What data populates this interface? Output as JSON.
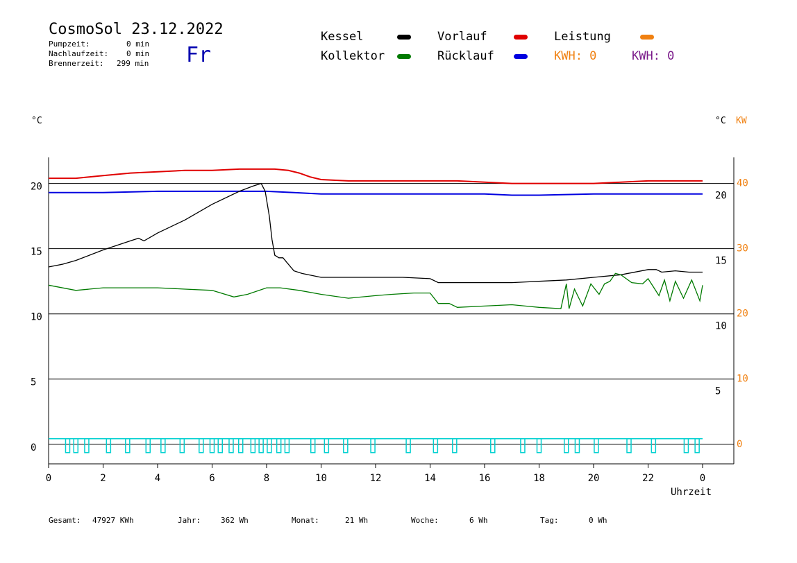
{
  "header": {
    "app_title": "CosmoSol 23.12.2022",
    "day": "Fr",
    "pumpzeit_label": "Pumpzeit:",
    "pumpzeit_value": "0 min",
    "nachlaufzeit_label": "Nachlaufzeit:",
    "nachlaufzeit_value": "0 min",
    "brennerzeit_label": "Brennerzeit:",
    "brennerzeit_value": "299 min"
  },
  "legend": {
    "kessel": "Kessel",
    "vorlauf": "Vorlauf",
    "leistung": "Leistung",
    "kollektor": "Kollektor",
    "ruecklauf": "Rücklauf",
    "kwh1": "KWH: 0",
    "kwh2": "KWH: 0",
    "colors": {
      "kessel": "#000000",
      "vorlauf": "#e00000",
      "leistung": "#f08010",
      "kollektor": "#007a00",
      "ruecklauf": "#0000e0",
      "kwh2": "#7a1a8a",
      "pump": "#00d0d0"
    }
  },
  "footer": {
    "gesamt_label": "Gesamt:",
    "gesamt_value": "47927 KWh",
    "jahr_label": "Jahr:",
    "jahr_value": "362 Wh",
    "monat_label": "Monat:",
    "monat_value": "21 Wh",
    "woche_label": "Woche:",
    "woche_value": "6 Wh",
    "tag_label": "Tag:",
    "tag_value": "0 Wh"
  },
  "chart_data": {
    "type": "line",
    "xlabel": "Uhrzeit",
    "ylabel_left": "°C",
    "ylabel_right": "°C",
    "ylabel_right2": "KW",
    "xlim": [
      0,
      24
    ],
    "ylim": [
      -1.5,
      22
    ],
    "grid": true,
    "x_ticks": [
      "0",
      "2",
      "4",
      "6",
      "8",
      "10",
      "12",
      "14",
      "16",
      "18",
      "20",
      "22",
      "0"
    ],
    "y_ticks_left": [
      "0",
      "5",
      "10",
      "15",
      "20"
    ],
    "y_ticks_right": [
      "5",
      "10",
      "15",
      "20"
    ],
    "y_ticks_kw": [
      "0",
      "10",
      "20",
      "30",
      "40"
    ],
    "series": [
      {
        "name": "Vorlauf",
        "color": "#e00000",
        "x": [
          0,
          1,
          2,
          3,
          4,
          5,
          6,
          7,
          7.5,
          8,
          8.3,
          8.8,
          9.2,
          9.6,
          10,
          11,
          12,
          13,
          14,
          15,
          16,
          17,
          18,
          19,
          20,
          21,
          22,
          23,
          24
        ],
        "y": [
          20.4,
          20.4,
          20.6,
          20.8,
          20.9,
          21.0,
          21.0,
          21.1,
          21.1,
          21.1,
          21.1,
          21.0,
          20.8,
          20.5,
          20.3,
          20.2,
          20.2,
          20.2,
          20.2,
          20.2,
          20.1,
          20.0,
          20.0,
          20.0,
          20.0,
          20.1,
          20.2,
          20.2,
          20.2
        ]
      },
      {
        "name": "Rücklauf",
        "color": "#0000e0",
        "x": [
          0,
          2,
          4,
          6,
          8,
          9,
          10,
          12,
          14,
          16,
          17,
          18,
          20,
          22,
          24
        ],
        "y": [
          19.3,
          19.3,
          19.4,
          19.4,
          19.4,
          19.3,
          19.2,
          19.2,
          19.2,
          19.2,
          19.1,
          19.1,
          19.2,
          19.2,
          19.2
        ]
      },
      {
        "name": "Kessel",
        "color": "#000000",
        "x": [
          0,
          0.5,
          1,
          2,
          3,
          3.3,
          3.5,
          4,
          5,
          6,
          7,
          7.5,
          7.8,
          7.95,
          8.1,
          8.2,
          8.3,
          8.45,
          8.6,
          9,
          9.3,
          10,
          11,
          12,
          13,
          14,
          14.3,
          15,
          16,
          17,
          18,
          19,
          20,
          21,
          22,
          22.3,
          22.5,
          23,
          23.5,
          24
        ],
        "y": [
          13.6,
          13.8,
          14.1,
          14.9,
          15.6,
          15.8,
          15.6,
          16.2,
          17.2,
          18.4,
          19.4,
          19.8,
          20.0,
          19.4,
          17.5,
          15.7,
          14.5,
          14.3,
          14.3,
          13.3,
          13.1,
          12.8,
          12.8,
          12.8,
          12.8,
          12.7,
          12.4,
          12.4,
          12.4,
          12.4,
          12.5,
          12.6,
          12.8,
          13.0,
          13.4,
          13.4,
          13.2,
          13.3,
          13.2,
          13.2
        ]
      },
      {
        "name": "Kollektor",
        "color": "#007a00",
        "x": [
          0,
          1,
          2,
          3,
          4,
          5,
          6,
          6.8,
          7.3,
          8,
          8.5,
          9.2,
          10,
          11,
          12,
          12.6,
          13.4,
          14,
          14.3,
          14.7,
          15,
          16,
          17,
          18,
          18.8,
          19.0,
          19.1,
          19.3,
          19.6,
          19.9,
          20.2,
          20.4,
          20.6,
          20.8,
          21.0,
          21.4,
          21.8,
          22.0,
          22.4,
          22.6,
          22.8,
          23.0,
          23.3,
          23.6,
          23.9,
          24
        ],
        "y": [
          12.2,
          11.8,
          12.0,
          12.0,
          12.0,
          11.9,
          11.8,
          11.3,
          11.5,
          12.0,
          12.0,
          11.8,
          11.5,
          11.2,
          11.4,
          11.5,
          11.6,
          11.6,
          10.8,
          10.8,
          10.5,
          10.6,
          10.7,
          10.5,
          10.4,
          12.3,
          10.4,
          11.9,
          10.6,
          12.3,
          11.5,
          12.3,
          12.5,
          13.1,
          13.0,
          12.4,
          12.3,
          12.7,
          11.4,
          12.6,
          11.0,
          12.5,
          11.2,
          12.6,
          11.0,
          12.2
        ]
      }
    ],
    "pump_pulses_x": [
      0.7,
      1.0,
      1.4,
      2.2,
      2.9,
      3.65,
      4.2,
      4.9,
      5.6,
      6.0,
      6.3,
      6.7,
      7.05,
      7.5,
      7.8,
      8.1,
      8.45,
      8.75,
      9.7,
      10.2,
      10.9,
      11.9,
      13.2,
      14.2,
      14.9,
      16.3,
      17.4,
      18.0,
      19.0,
      19.4,
      20.1,
      21.3,
      22.2,
      23.4,
      23.8
    ]
  }
}
